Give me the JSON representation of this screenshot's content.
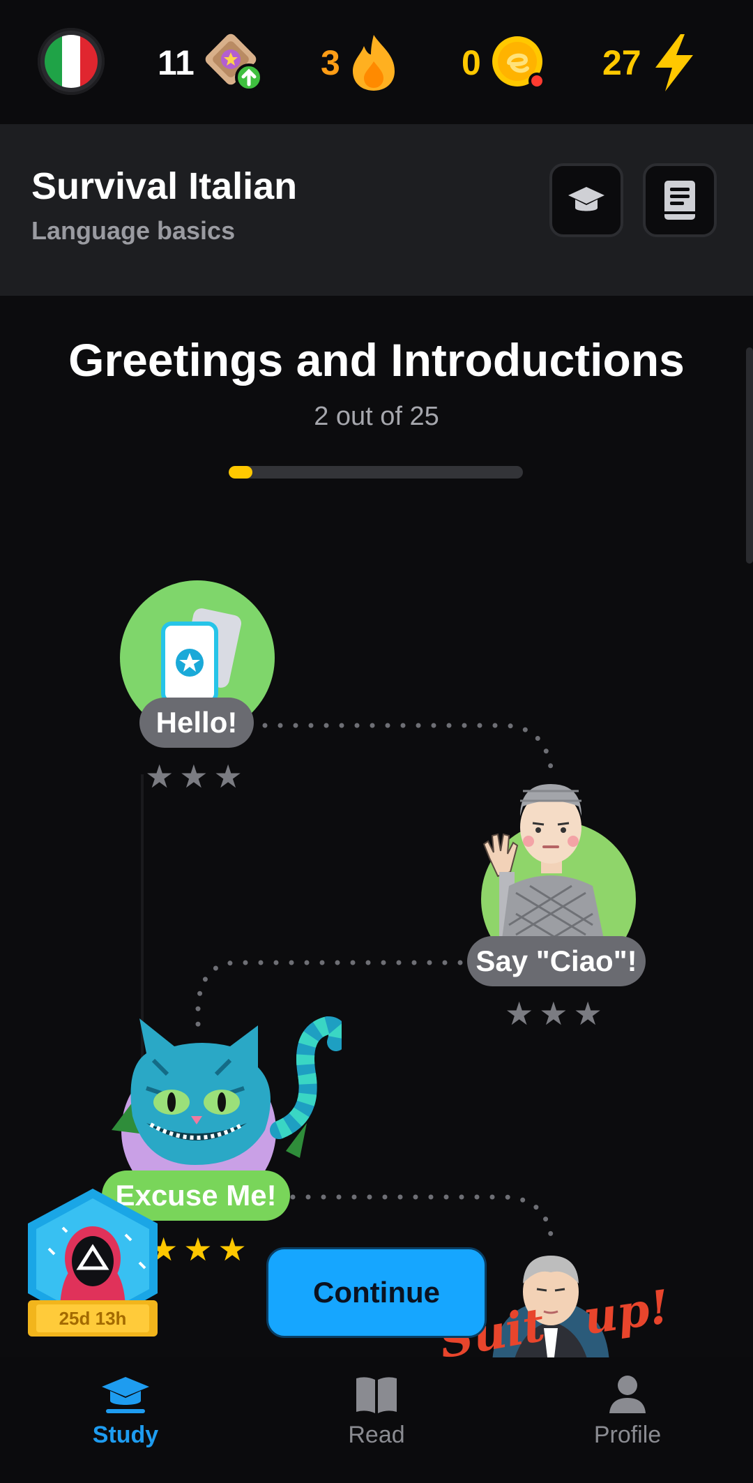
{
  "topbar": {
    "flag_colors": [
      "#1fa347",
      "#ffffff",
      "#e0262f"
    ],
    "stats": [
      {
        "icon": "medal-level-up-icon",
        "value": "11",
        "color": "#ffffff"
      },
      {
        "icon": "flame-streak-icon",
        "value": "3",
        "color": "#ff9d16"
      },
      {
        "icon": "coin-icon",
        "value": "0",
        "color": "#ffc800"
      },
      {
        "icon": "lightning-energy-icon",
        "value": "27",
        "color": "#ffc800"
      }
    ]
  },
  "course": {
    "title": "Survival Italian",
    "subtitle": "Language basics",
    "buttons": [
      "graduation-cap-icon",
      "book-icon"
    ]
  },
  "section": {
    "title": "Greetings and Introductions",
    "progress_text": "2 out of 25",
    "progress_fraction": 0.08
  },
  "lessons": [
    {
      "label": "Hello!",
      "stars_earned": 0,
      "stars_total": 3,
      "icon": "flashcards-icon",
      "color": "#7fd66b"
    },
    {
      "label": "Say \"Ciao\"!",
      "stars_earned": 0,
      "stars_total": 3,
      "icon": "waving-man-avatar",
      "color": "#8fd56a"
    },
    {
      "label": "Excuse Me!",
      "stars_earned": 3,
      "stars_total": 3,
      "icon": "cheshire-cat-icon",
      "color": "#79d55a"
    },
    {
      "label": "Suit up!",
      "icon": "businessman-avatar"
    }
  ],
  "event_badge": {
    "timer": "25d 13h",
    "icon": "masked-guard-icon"
  },
  "continue_label": "Continue",
  "bottom_nav": [
    {
      "label": "Study",
      "icon": "graduation-cap-icon",
      "active": true
    },
    {
      "label": "Read",
      "icon": "open-book-icon",
      "active": false
    },
    {
      "label": "Profile",
      "icon": "person-icon",
      "active": false
    }
  ],
  "colors": {
    "accent_blue": "#1e9cf0",
    "star_gold": "#ffc800",
    "star_gray": "#7b7c82"
  }
}
